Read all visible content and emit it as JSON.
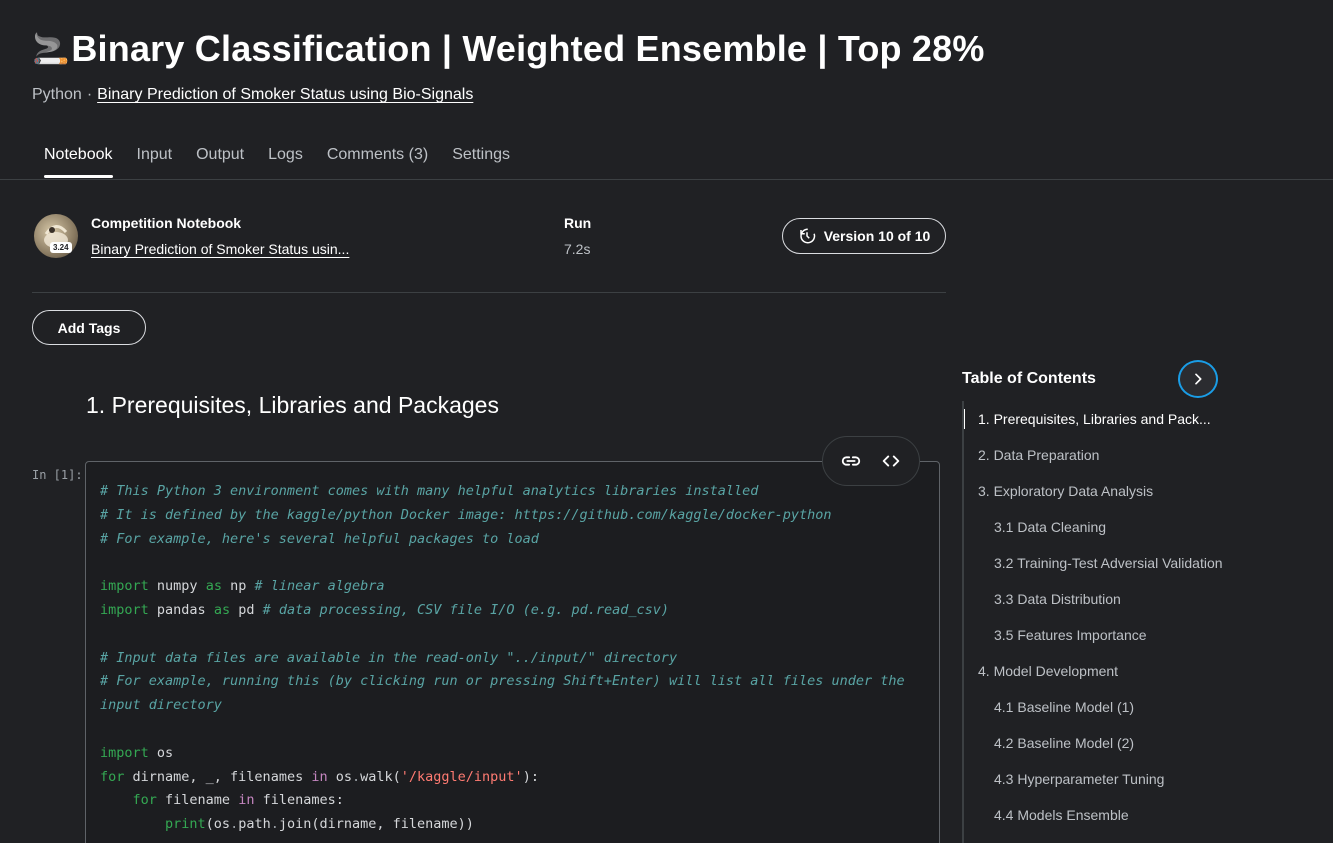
{
  "header": {
    "emoji": "🚬",
    "title": "Binary Classification | Weighted Ensemble | Top 28%",
    "language": "Python",
    "separator": "·",
    "competition_link": "Binary Prediction of Smoker Status using Bio-Signals"
  },
  "tabs": [
    {
      "label": "Notebook",
      "active": true
    },
    {
      "label": "Input"
    },
    {
      "label": "Output"
    },
    {
      "label": "Logs"
    },
    {
      "label": "Comments (3)"
    },
    {
      "label": "Settings"
    }
  ],
  "info": {
    "avatar_badge": "3.24",
    "type_label": "Competition Notebook",
    "competition_short": "Binary Prediction of Smoker Status usin...",
    "run_label": "Run",
    "run_value": "7.2s",
    "version_label": "Version 10 of 10",
    "add_tags_label": "Add Tags"
  },
  "section": {
    "heading": "1. Prerequisites, Libraries and Packages"
  },
  "cell": {
    "label": "In [1]:",
    "code": {
      "l1": "# This Python 3 environment comes with many helpful analytics libraries installed",
      "l2": "# It is defined by the kaggle/python Docker image: https://github.com/kaggle/docker-python",
      "l3": "# For example, here's several helpful packages to load",
      "l5_kw1": "import",
      "l5_mod": " numpy ",
      "l5_kw2": "as",
      "l5_alias": " np ",
      "l5_cm": "# linear algebra",
      "l6_kw1": "import",
      "l6_mod": " pandas ",
      "l6_kw2": "as",
      "l6_alias": " pd ",
      "l6_cm": "# data processing, CSV file I/O (e.g. pd.read_csv)",
      "l8": "# Input data files are available in the read-only \"../input/\" directory",
      "l9": "# For example, running this (by clicking run or pressing Shift+Enter) will list all files under the",
      "l10": "input directory",
      "l12_kw": "import",
      "l12_mod": " os",
      "l13_kw": "for",
      "l13_a": " dirname, _, filenames ",
      "l13_in": "in",
      "l13_b": " os",
      "l13_dot": ".",
      "l13_c": "walk(",
      "l13_str": "'/kaggle/input'",
      "l13_d": "):",
      "l14_kw": "for",
      "l14_a": " filename ",
      "l14_in": "in",
      "l14_b": " filenames:",
      "l15_fn": "print",
      "l15_a": "(os",
      "l15_dot1": ".",
      "l15_b": "path",
      "l15_dot2": ".",
      "l15_c": "join(dirname, filename))"
    }
  },
  "toc": {
    "title": "Table of Contents",
    "items": [
      {
        "label": "1. Prerequisites, Libraries and Pack...",
        "level": 1,
        "active": true
      },
      {
        "label": "2. Data Preparation",
        "level": 1
      },
      {
        "label": "3. Exploratory Data Analysis",
        "level": 1
      },
      {
        "label": "3.1 Data Cleaning",
        "level": 2
      },
      {
        "label": "3.2 Training-Test Adversial Validation",
        "level": 2
      },
      {
        "label": "3.3 Data Distribution",
        "level": 2
      },
      {
        "label": "3.5 Features Importance",
        "level": 2
      },
      {
        "label": "4. Model Development",
        "level": 1
      },
      {
        "label": "4.1 Baseline Model (1)",
        "level": 2
      },
      {
        "label": "4.2 Baseline Model (2)",
        "level": 2
      },
      {
        "label": "4.3 Hyperparameter Tuning",
        "level": 2
      },
      {
        "label": "4.4 Models Ensemble",
        "level": 2
      }
    ]
  },
  "colors": {
    "background": "#202124",
    "accent_ring": "#1a9de6",
    "comment": "#59a4a4",
    "keyword": "#34a853",
    "string": "#ff7b72"
  }
}
